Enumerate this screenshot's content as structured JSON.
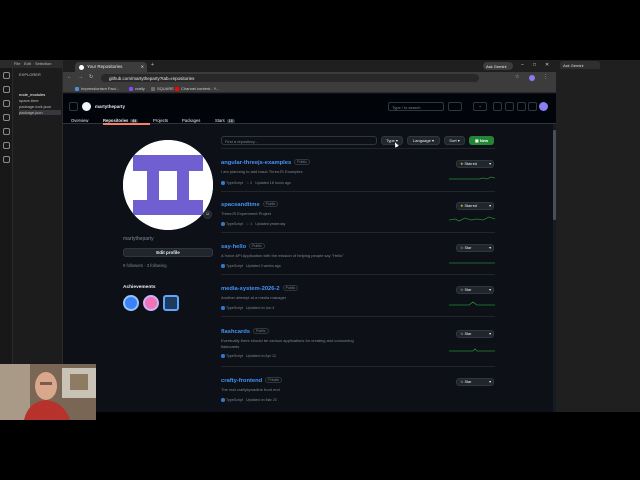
{
  "editor": {
    "menu": [
      "File",
      "Edit",
      "Selection"
    ],
    "explorer_title": "EXPLORER",
    "tree": [
      "&gt;&gt;&gt;&gt;&gt;",
      "node_modules",
      "space-time",
      "package-lock.json",
      "package.json"
    ]
  },
  "browser": {
    "tab_title": "Your Repositories",
    "url": "github.com/martytheparty?tab=repositories",
    "ask_gemini": "Ask Gemini",
    "bookmarks": [
      "Impressionism Fact...",
      "crafty",
      "SQUARE",
      "Channel content - Y..."
    ],
    "bookmark_colors": [
      "#4a90d9",
      "#7c4dff",
      "#3a3a3a",
      "#ff0000"
    ]
  },
  "gemini": {
    "tab_label": "Ask Gemini"
  },
  "github": {
    "username": "martytheparty",
    "search_placeholder": "Type / to search",
    "tabs": [
      {
        "label": "Overview",
        "count": ""
      },
      {
        "label": "Repositories",
        "count": "64"
      },
      {
        "label": "Projects",
        "count": ""
      },
      {
        "label": "Packages",
        "count": ""
      },
      {
        "label": "Stars",
        "count": "18"
      }
    ],
    "profile": {
      "name": "martytheparty",
      "edit_label": "Edit profile",
      "followers_text": "9 followers · 3 following",
      "achievements_title": "Achievements"
    },
    "filters": {
      "find_placeholder": "Find a repository...",
      "type_label": "Type ▾",
      "language_label": "Language ▾",
      "sort_label": "Sort ▾",
      "new_label": "New"
    },
    "repos": [
      {
        "name": "angular-threejs-examples",
        "visibility": "Public",
        "desc": "I am planning to add basic ThreeJS Examples",
        "lang": "TypeScript",
        "stars": "2",
        "updated": "Updated 18 hours ago",
        "star_label": "Starred",
        "starred": true
      },
      {
        "name": "spaceandtime",
        "visibility": "Public",
        "desc": "ThreeJS Experiment Project",
        "lang": "TypeScript",
        "stars": "1",
        "updated": "Updated yesterday",
        "star_label": "Starred",
        "starred": true
      },
      {
        "name": "say-hello",
        "visibility": "Public",
        "desc": "A Voice API Application with the mission of helping people say \"Hello\"",
        "lang": "TypeScript",
        "stars": "",
        "updated": "Updated 3 weeks ago",
        "star_label": "Star",
        "starred": false
      },
      {
        "name": "media-system-2026-2",
        "visibility": "Public",
        "desc": "Another attempt at a media manager",
        "lang": "TypeScript",
        "stars": "",
        "updated": "Updated on Jun 4",
        "star_label": "Star",
        "starred": false
      },
      {
        "name": "flashcards",
        "visibility": "Public",
        "desc": "Eventually there should be various applications for creating and consuming flashcards",
        "lang": "TypeScript",
        "stars": "",
        "updated": "Updated on Apr 12",
        "star_label": "Star",
        "starred": false
      },
      {
        "name": "crafty-frontend",
        "visibility": "Private",
        "desc": "The real craftybynadine front end",
        "lang": "TypeScript",
        "stars": "",
        "updated": "Updated on Mar 20",
        "star_label": "Star",
        "starred": false
      }
    ]
  },
  "colors": {
    "accent_blue": "#4493f8",
    "new_green": "#238636",
    "tab_underline": "#f78166",
    "avatar_purple": "#6f5fd0"
  }
}
